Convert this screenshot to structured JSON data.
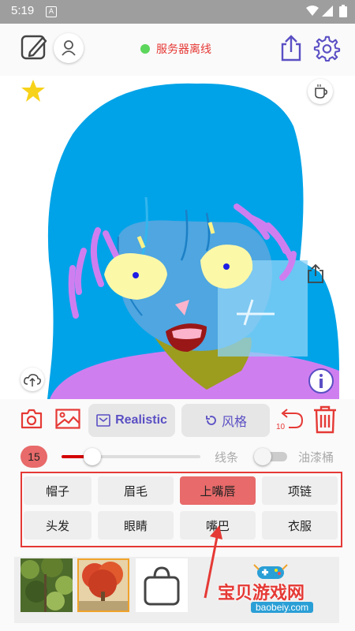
{
  "status_bar": {
    "time": "5:19",
    "app_icon_letter": "A"
  },
  "header": {
    "server_status": "服务器离线",
    "status_color": "#5cd65c"
  },
  "toolbar": {
    "realistic_label": "Realistic",
    "style_label": "风格",
    "undo_count": "10"
  },
  "brush": {
    "size": "15",
    "size_fraction": 0.22,
    "line_label": "线条",
    "bucket_label": "油漆桶",
    "bucket_enabled": false
  },
  "parts": [
    {
      "label": "帽子",
      "active": false
    },
    {
      "label": "眉毛",
      "active": false
    },
    {
      "label": "上嘴唇",
      "active": true
    },
    {
      "label": "项链",
      "active": false
    },
    {
      "label": "头发",
      "active": false
    },
    {
      "label": "眼睛",
      "active": false
    },
    {
      "label": "嘴巴",
      "active": false
    },
    {
      "label": "衣服",
      "active": false
    }
  ],
  "watermark": {
    "title": "宝贝游戏网",
    "url": "baobeiy.com"
  },
  "colors": {
    "accent": "#5a4fc4",
    "danger": "#e53935",
    "active_part": "#e86a6a"
  }
}
